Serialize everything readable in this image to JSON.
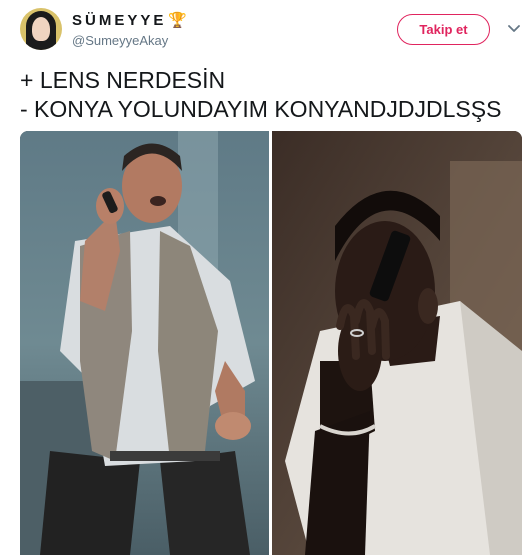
{
  "user": {
    "display_name": "SÜMEYYE",
    "badge_icon": "trophy-icon",
    "handle": "@SumeyyeAkay"
  },
  "actions": {
    "follow_label": "Takip et",
    "menu_icon": "chevron-down-icon"
  },
  "tweet": {
    "lines": [
      "+ LENS NERDESİN",
      "- KONYA YOLUNDAYIM KONYANDJDJDLSŞS"
    ]
  },
  "media": {
    "panels": [
      "left-photo-man-on-phone",
      "right-photo-man-on-phone"
    ]
  },
  "colors": {
    "accent": "#e0245e",
    "muted": "#657786",
    "trophy": "#e8a41c"
  }
}
